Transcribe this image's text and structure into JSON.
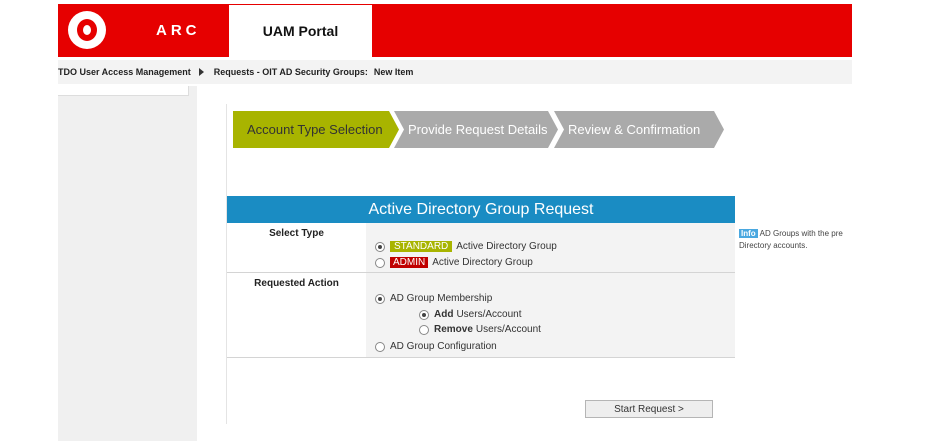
{
  "header": {
    "brand": "ARC",
    "portal_title": "UAM Portal"
  },
  "breadcrumb": {
    "items": [
      "TDO User Access Management",
      "Requests - OIT AD Security Groups:",
      "New Item"
    ]
  },
  "wizard": {
    "steps": [
      {
        "label": "Account Type Selection",
        "active": true
      },
      {
        "label": "Provide Request Details",
        "active": false
      },
      {
        "label": "Review & Confirmation",
        "active": false
      }
    ]
  },
  "form": {
    "title": "Active Directory Group Request",
    "select_type": {
      "label": "Select Type",
      "options": [
        {
          "badge": "STANDARD",
          "text": "Active Directory Group",
          "selected": true
        },
        {
          "badge": "ADMIN",
          "text": "Active Directory Group",
          "selected": false
        }
      ]
    },
    "requested_action": {
      "label": "Requested Action",
      "membership": {
        "text": "AD Group Membership",
        "selected": true
      },
      "add": {
        "bold": "Add",
        "text": "Users/Account",
        "selected": true
      },
      "remove": {
        "bold": "Remove",
        "text": "Users/Account",
        "selected": false
      },
      "configuration": {
        "text": "AD Group Configuration",
        "selected": false
      }
    },
    "start_button": "Start Request >"
  },
  "info": {
    "tag": "Info",
    "line1": "AD Groups with the pre",
    "line2": "Directory  accounts."
  },
  "colors": {
    "brand_red": "#e60000",
    "active_step": "#a8b400",
    "inactive_step": "#aaaaaa",
    "form_header": "#1a8cc3",
    "admin_badge": "#c00000"
  }
}
